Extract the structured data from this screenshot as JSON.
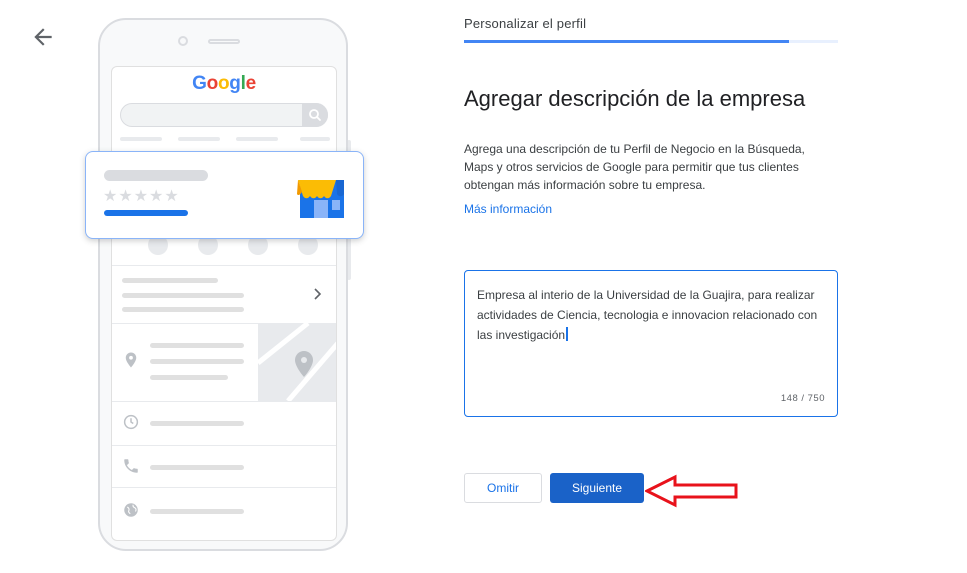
{
  "header": {
    "step_label": "Personalizar el perfil",
    "progress": 0.87
  },
  "illustration": {
    "logo_text": "Google",
    "rating_stars": "★★★★★"
  },
  "form": {
    "title": "Agregar descripción de la empresa",
    "description": "Agrega una descripción de tu Perfil de Negocio en la Búsqueda, Maps y otros servicios de Google para permitir que tus clientes obtengan más información sobre tu empresa.",
    "more_link": "Más información",
    "textarea_value": "Empresa al interio de la Universidad de la Guajira, para realizar actividades de Ciencia, tecnologia e innovacion relacionado con las investigación",
    "char_counter": "148 / 750"
  },
  "buttons": {
    "skip_label": "Omitir",
    "next_label": "Siguiente"
  },
  "icons": {
    "back": "arrow-back-icon",
    "annotation": "red-arrow-icon"
  },
  "colors": {
    "accent": "#1a73e8",
    "primary_button": "#1a62c8",
    "annotation_arrow": "#e8121b"
  }
}
